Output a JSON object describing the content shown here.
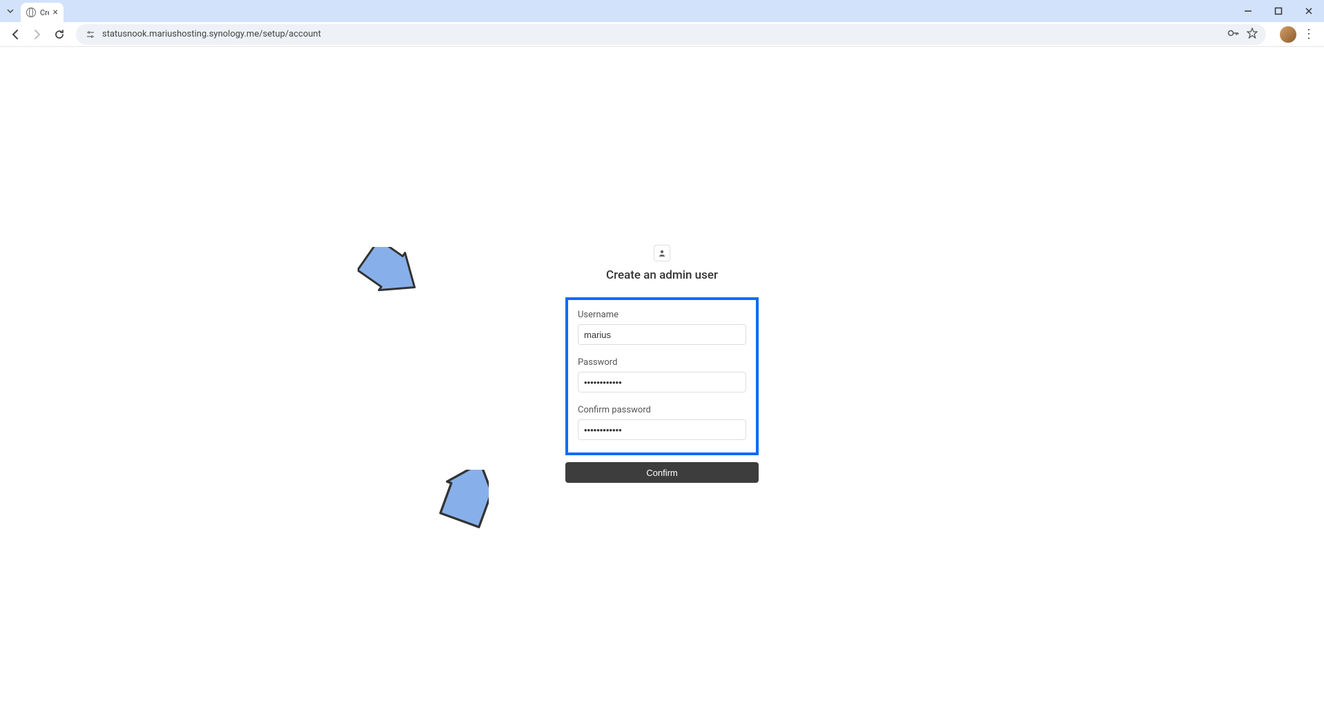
{
  "browser": {
    "tab_title": "Cre",
    "url": "statusnook.mariushosting.synology.me/setup/account"
  },
  "page": {
    "title": "Create an admin user",
    "form": {
      "username_label": "Username",
      "username_value": "marius",
      "password_label": "Password",
      "password_value": "••••••••••••",
      "confirm_password_label": "Confirm password",
      "confirm_password_value": "••••••••••••",
      "submit_label": "Confirm"
    }
  }
}
